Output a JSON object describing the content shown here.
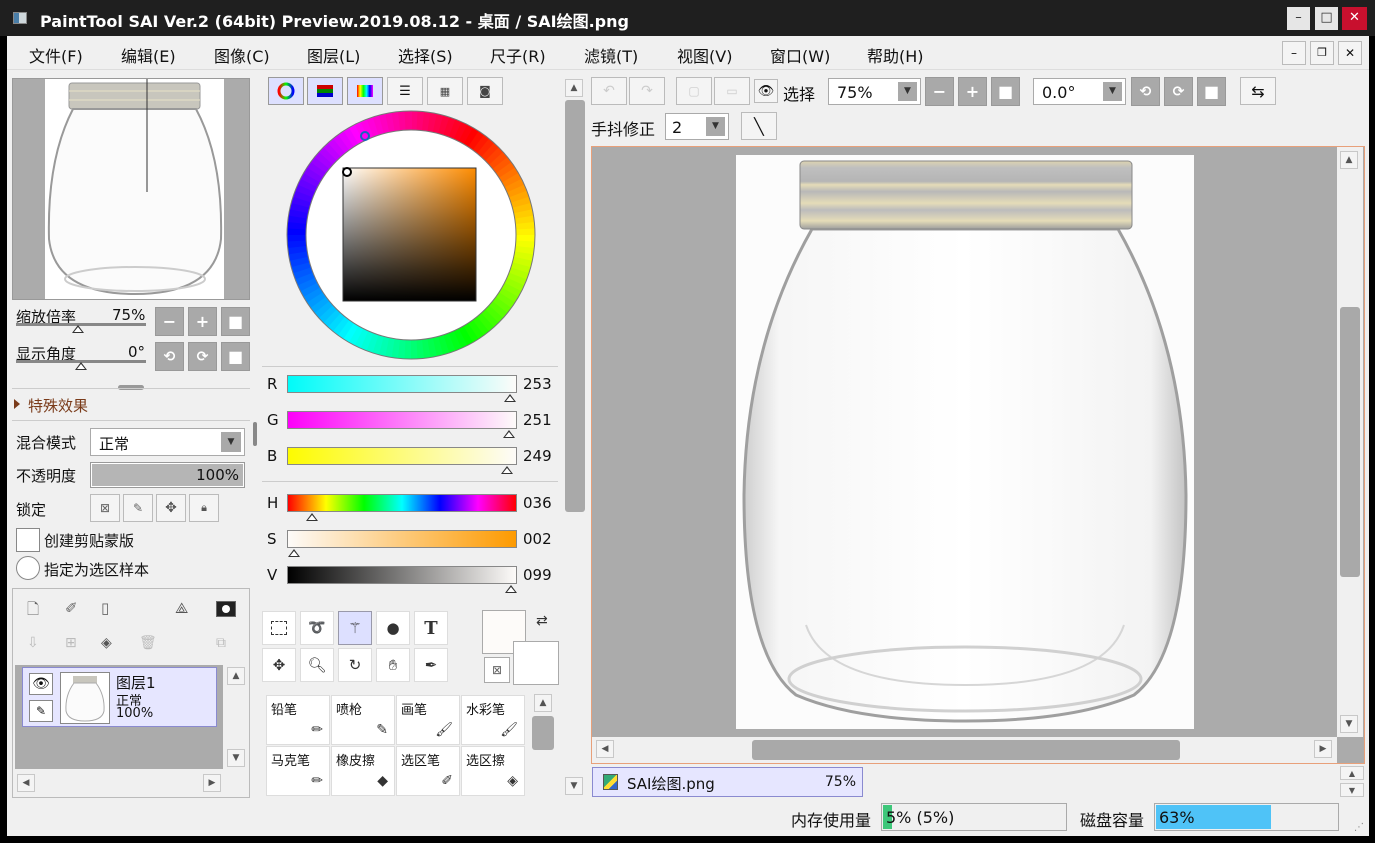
{
  "window": {
    "title": "PaintTool SAI Ver.2 (64bit) Preview.2019.08.12 - 桌面 / SAI绘图.png",
    "minimize_glyph": "–",
    "maximize_glyph": "□",
    "close_glyph": "✕"
  },
  "menu": [
    "文件(F)",
    "编辑(E)",
    "图像(C)",
    "图层(L)",
    "选择(S)",
    "尺子(R)",
    "滤镜(T)",
    "视图(V)",
    "窗口(W)",
    "帮助(H)"
  ],
  "navigator": {
    "zoom_label": "缩放倍率",
    "zoom_value": "75%",
    "angle_label": "显示角度",
    "angle_value": "0°"
  },
  "layer_props": {
    "effects_label": "特殊效果",
    "blend_label": "混合模式",
    "blend_value": "正常",
    "opacity_label": "不透明度",
    "opacity_value": "100%",
    "opacity_fraction": 1.0,
    "lock_label": "锁定",
    "clip_label": "创建剪贴蒙版",
    "sample_label": "指定为选区样本"
  },
  "layer": {
    "name": "图层1",
    "mode": "正常",
    "opacity": "100%"
  },
  "color": {
    "rgb": [
      {
        "label": "R",
        "value": "253"
      },
      {
        "label": "G",
        "value": "251"
      },
      {
        "label": "B",
        "value": "249"
      }
    ],
    "hsv": [
      {
        "label": "H",
        "value": "036"
      },
      {
        "label": "S",
        "value": "002"
      },
      {
        "label": "V",
        "value": "099"
      }
    ]
  },
  "brushes": [
    {
      "name": "铅笔",
      "icon": "pencil-icon"
    },
    {
      "name": "喷枪",
      "icon": "airbrush-icon"
    },
    {
      "name": "画笔",
      "icon": "brush-icon"
    },
    {
      "name": "水彩笔",
      "icon": "watercolor-icon"
    },
    {
      "name": "马克笔",
      "icon": "marker-icon"
    },
    {
      "name": "橡皮擦",
      "icon": "eraser-icon"
    },
    {
      "name": "选区笔",
      "icon": "selection-pen-icon"
    },
    {
      "name": "选区擦",
      "icon": "selection-eraser-icon"
    }
  ],
  "toolbar": {
    "select_label": "选择",
    "zoom_value": "75%",
    "angle_value": "0.0°",
    "stabilizer_label": "手抖修正",
    "stabilizer_value": "2"
  },
  "document_tab": {
    "name": "SAI绘图.png",
    "zoom": "75%"
  },
  "status": {
    "memory_label": "内存使用量",
    "memory_value": "5% (5%)",
    "memory_fraction": 0.05,
    "disk_label": "磁盘容量",
    "disk_value": "63%",
    "disk_fraction": 0.63
  },
  "colors": {
    "titlebar": "#1f1f1f",
    "close_red": "#c8102e",
    "panel_bg": "#f0f0f0",
    "canvas_bg": "#ababab",
    "accent_border": "#e8a07a",
    "disk_bar": "#4fc3f7",
    "memory_bar": "#3ec77a"
  }
}
